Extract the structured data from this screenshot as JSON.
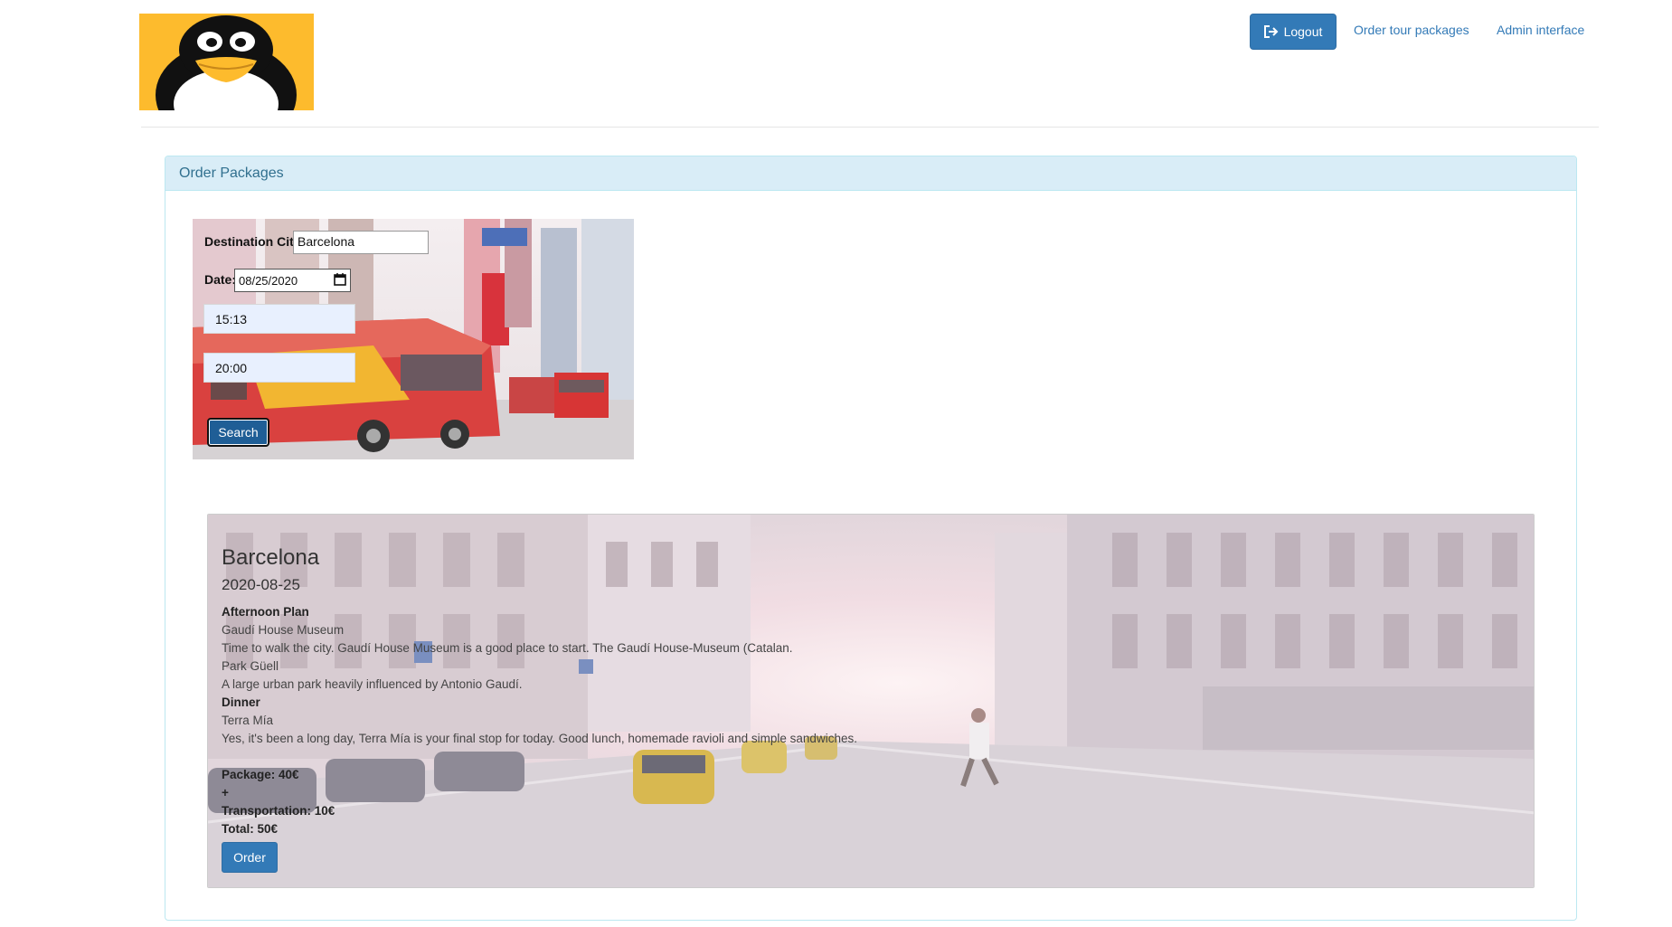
{
  "header": {
    "logo": "tux-penguin-logo",
    "nav": {
      "logout_label": "Logout",
      "logout_icon": "logout-icon",
      "order_link": "Order tour packages",
      "admin_link": "Admin interface"
    }
  },
  "panel": {
    "title": "Order Packages"
  },
  "search_form": {
    "destination_label": "Destination City:",
    "destination_value": "Barcelona",
    "date_label": "Date:",
    "date_value": "08/25/2020",
    "start_time": "15:13",
    "end_time": "20:00",
    "search_label": "Search",
    "calendar_icon": "calendar-icon"
  },
  "result": {
    "city": "Barcelona",
    "date": "2020-08-25",
    "afternoon_heading": "Afternoon Plan",
    "stop1_name": "Gaudí House Museum",
    "stop1_desc": "Time to walk the city. Gaudí House Museum is a good place to start. The Gaudí House-Museum (Catalan.",
    "stop2_name": "Park Güell",
    "stop2_desc": "A large urban park heavily influenced by Antonio Gaudí.",
    "dinner_heading": "Dinner",
    "dinner_name": "Terra Mía",
    "dinner_desc": "Yes, it's been a long day, Terra Mía is your final stop for today. Good lunch, homemade ravioli and simple sandwiches.",
    "package_price": "Package: 40€",
    "plus": "+",
    "transportation_price": "Transportation: 10€",
    "total_price": "Total: 50€",
    "order_label": "Order"
  },
  "colors": {
    "primary": "#337ab7",
    "panel_heading_bg": "#d9edf7",
    "panel_heading_text": "#31708f",
    "logo_bg": "#fdbb2d"
  }
}
